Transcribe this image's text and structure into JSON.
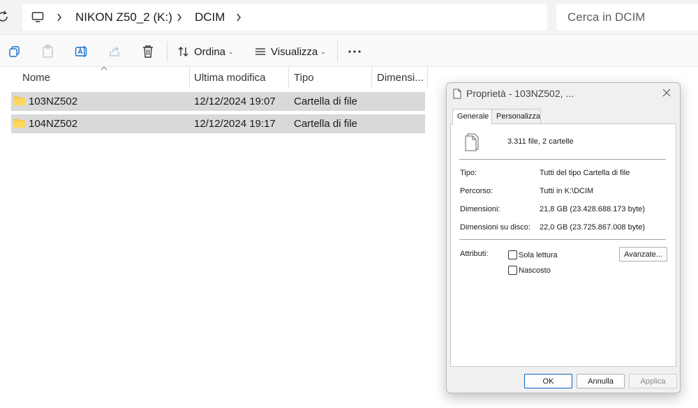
{
  "address_bar": {
    "crumbs": [
      "NIKON Z50_2 (K:)",
      "DCIM"
    ],
    "search_placeholder": "Cerca in DCIM"
  },
  "toolbar": {
    "sort_label": "Ordina",
    "view_label": "Visualizza"
  },
  "columns": {
    "name": "Nome",
    "modified": "Ultima modifica",
    "type": "Tipo",
    "size": "Dimensi..."
  },
  "files": [
    {
      "name": "103NZ502",
      "modified": "12/12/2024 19:07",
      "type": "Cartella di file"
    },
    {
      "name": "104NZ502",
      "modified": "12/12/2024 19:17",
      "type": "Cartella di file"
    }
  ],
  "dialog": {
    "title": "Proprietà - 103NZ502, ...",
    "tabs": [
      "Generale",
      "Personalizza"
    ],
    "summary": "3.311 file, 2 cartelle",
    "props": [
      {
        "label": "Tipo:",
        "value": "Tutti del tipo Cartella di file"
      },
      {
        "label": "Percorso:",
        "value": "Tutti in K:\\DCIM"
      },
      {
        "label": "Dimensioni:",
        "value": "21,8 GB (23.428.688.173 byte)"
      },
      {
        "label": "Dimensioni su disco:",
        "value": "22,0 GB (23.725.867.008 byte)"
      }
    ],
    "attributes_label": "Attributi:",
    "readonly_label": "Sola lettura",
    "hidden_label": "Nascosto",
    "advanced_label": "Avanzate...",
    "ok_label": "OK",
    "cancel_label": "Annulla",
    "apply_label": "Applica"
  }
}
